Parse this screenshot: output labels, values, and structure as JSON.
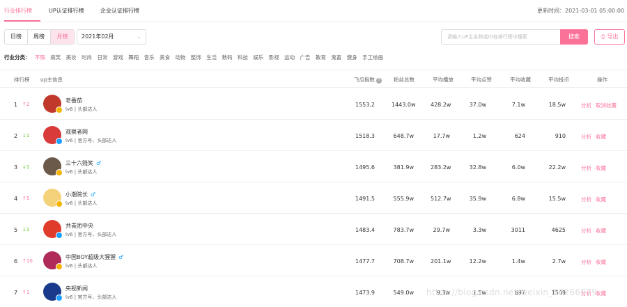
{
  "tabs": [
    {
      "label": "行业排行榜",
      "active": true
    },
    {
      "label": "UP认证排行榜",
      "active": false
    },
    {
      "label": "企业认证排行榜",
      "active": false
    }
  ],
  "update_time": "更新时间：2021-03-01 05:00:00",
  "periods": [
    {
      "label": "日榜",
      "active": false
    },
    {
      "label": "周榜",
      "active": false
    },
    {
      "label": "月榜",
      "active": true
    }
  ],
  "month_select": "2021年02月",
  "search": {
    "placeholder": "请输入UP主名称或ID在排行榜中搜索",
    "button": "搜索"
  },
  "export_label": "导出",
  "category": {
    "label": "行业分类：",
    "items": [
      "不限",
      "搞笑",
      "美妆",
      "时尚",
      "日常",
      "游戏",
      "舞蹈",
      "音乐",
      "美食",
      "动物",
      "整饰",
      "生活",
      "数码",
      "科技",
      "娱乐",
      "影视",
      "运动",
      "广告",
      "教育",
      "鬼畜",
      "健身",
      "手工绘画"
    ]
  },
  "columns": {
    "rank": "排行榜",
    "info": "up主信息",
    "feigua": "飞瓜指数",
    "fans": "粉丝总数",
    "play": "平均播放",
    "like": "平均点赞",
    "collect": "平均收藏",
    "coin": "平均投币",
    "ops": "操作"
  },
  "rows": [
    {
      "rank": "1",
      "change": "↑2",
      "dir": "up",
      "name": "老番茄",
      "gender": "",
      "sub": "lv6 | 头部达人",
      "feigua": "1553.2",
      "fans": "1443.0w",
      "play": "428.2w",
      "like": "37.0w",
      "collect": "7.1w",
      "coin": "18.5w",
      "a1": "分析",
      "a2": "取消收藏",
      "color": "#c0392b",
      "badge": "yellow"
    },
    {
      "rank": "2",
      "change": "↓1",
      "dir": "down",
      "name": "观察者网",
      "gender": "",
      "sub": "lv6 | 官方号、头部达人",
      "feigua": "1518.3",
      "fans": "648.7w",
      "play": "17.7w",
      "like": "1.2w",
      "collect": "624",
      "coin": "910",
      "a1": "分析",
      "a2": "收藏",
      "color": "#d93a3a",
      "badge": "blue"
    },
    {
      "rank": "3",
      "change": "↓1",
      "dir": "down",
      "name": "三十六贱笑",
      "gender": "♂",
      "sub": "lv6 | 头部达人",
      "feigua": "1495.6",
      "fans": "381.9w",
      "play": "283.2w",
      "like": "32.8w",
      "collect": "6.0w",
      "coin": "22.2w",
      "a1": "分析",
      "a2": "收藏",
      "color": "#6b5a4a",
      "badge": "yellow"
    },
    {
      "rank": "4",
      "change": "↑5",
      "dir": "up",
      "name": "小潮院长",
      "gender": "♂",
      "sub": "lv6 | 头部达人",
      "feigua": "1491.5",
      "fans": "555.9w",
      "play": "512.7w",
      "like": "35.9w",
      "collect": "6.8w",
      "coin": "15.5w",
      "a1": "分析",
      "a2": "收藏",
      "color": "#f4d27a",
      "badge": "yellow"
    },
    {
      "rank": "5",
      "change": "↓1",
      "dir": "down",
      "name": "共青团中央",
      "gender": "",
      "sub": "lv6 | 官方号、头部达人",
      "feigua": "1483.4",
      "fans": "783.7w",
      "play": "29.7w",
      "like": "3.3w",
      "collect": "3011",
      "coin": "4625",
      "a1": "分析",
      "a2": "收藏",
      "color": "#e03c2c",
      "badge": "blue"
    },
    {
      "rank": "6",
      "change": "↑10",
      "dir": "up",
      "name": "中国BOY超级大猩猩",
      "gender": "♂",
      "sub": "lv6 | 头部达人",
      "feigua": "1477.7",
      "fans": "708.7w",
      "play": "201.1w",
      "like": "12.2w",
      "collect": "1.4w",
      "coin": "2.7w",
      "a1": "分析",
      "a2": "收藏",
      "color": "#b02a5a",
      "badge": "yellow"
    },
    {
      "rank": "7",
      "change": "↑1",
      "dir": "up",
      "name": "央视新闻",
      "gender": "",
      "sub": "lv6 | 官方号、头部达人",
      "feigua": "1473.9",
      "fans": "549.0w",
      "play": "9.3w",
      "like": "1.5w",
      "collect": "697",
      "coin": "1509",
      "a1": "分析",
      "a2": "收藏",
      "color": "#1a3a8c",
      "badge": "blue"
    }
  ],
  "watermark": "https://blog.csdn.net/weixin_56266079"
}
